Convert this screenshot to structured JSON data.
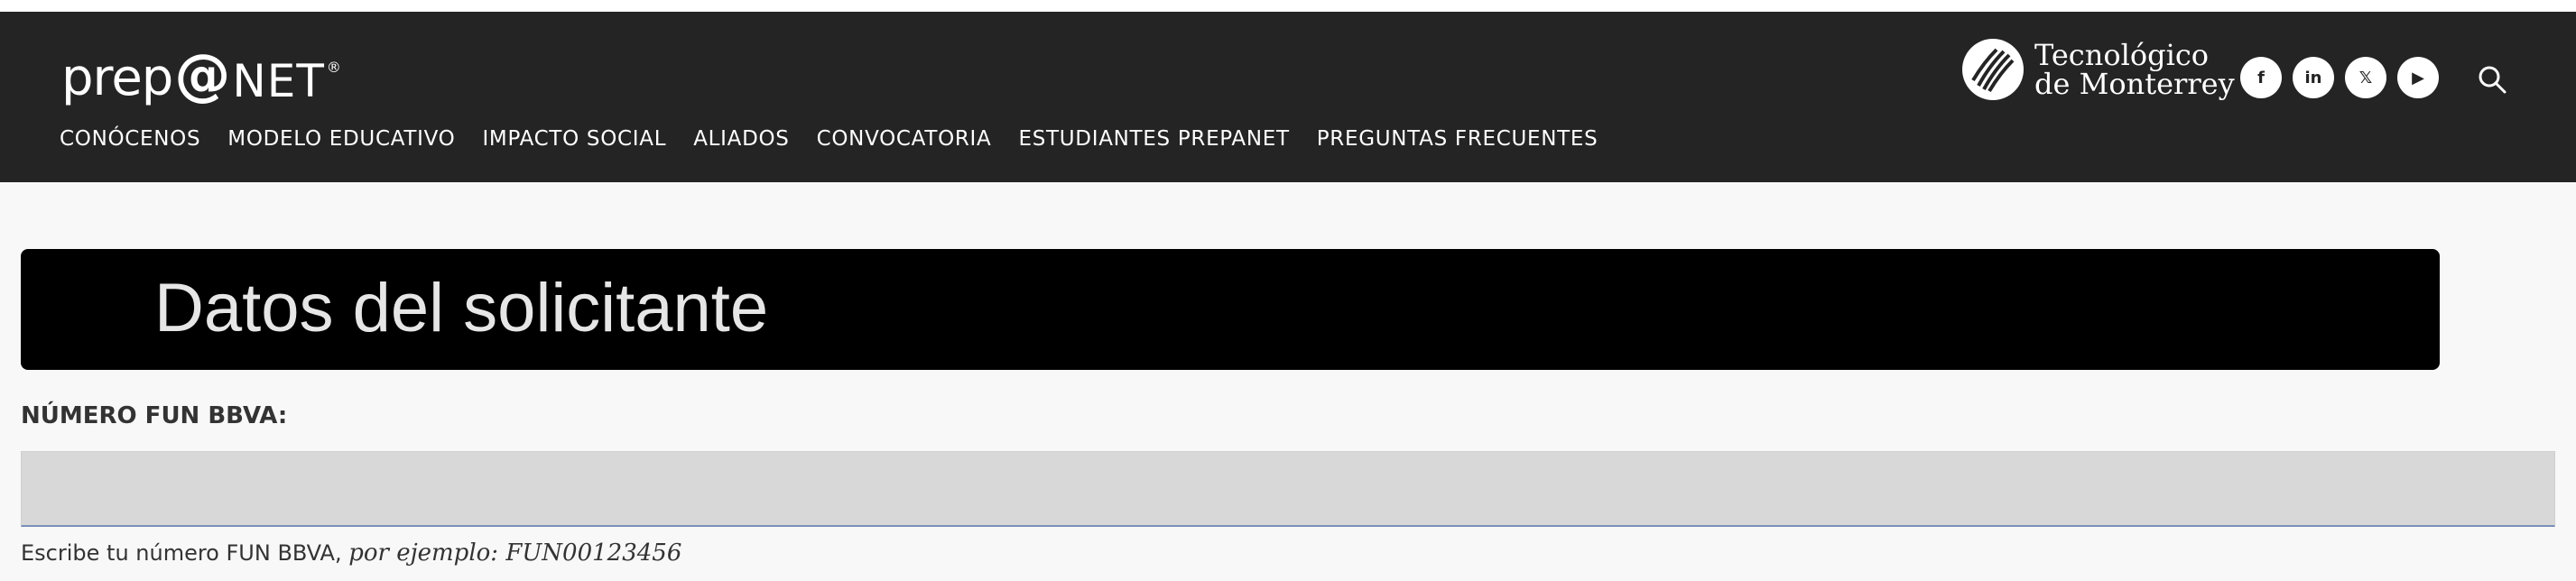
{
  "header": {
    "logo": {
      "part1": "prep",
      "part2": "@",
      "part3": "NET",
      "mark": "®"
    },
    "menu": [
      "CONÓCENOS",
      "MODELO EDUCATIVO",
      "IMPACTO SOCIAL",
      "ALIADOS",
      "CONVOCATORIA",
      "ESTUDIANTES PREPANET",
      "PREGUNTAS FRECUENTES"
    ],
    "tec_logo": {
      "line1": "Tecnológico",
      "line2": "de Monterrey"
    },
    "social": [
      {
        "icon": "facebook-icon",
        "glyph": "f"
      },
      {
        "icon": "linkedin-icon",
        "glyph": "in"
      },
      {
        "icon": "x-icon",
        "glyph": "𝕏"
      },
      {
        "icon": "youtube-icon",
        "glyph": "▶"
      }
    ],
    "search_icon": "search-icon"
  },
  "form": {
    "section_title": "Datos del solicitante",
    "fun_label": "NÚMERO FUN BBVA:",
    "fun_value": "",
    "fun_help": "Escribe tu número FUN BBVA, ",
    "fun_help_example": "por ejemplo: FUN00123456"
  },
  "colors": {
    "header_bg": "#242424",
    "banner_bg": "#000000",
    "input_bg": "#d8d8d8",
    "input_underline": "#7b8fb8",
    "page_bg": "#f8f8f8"
  }
}
